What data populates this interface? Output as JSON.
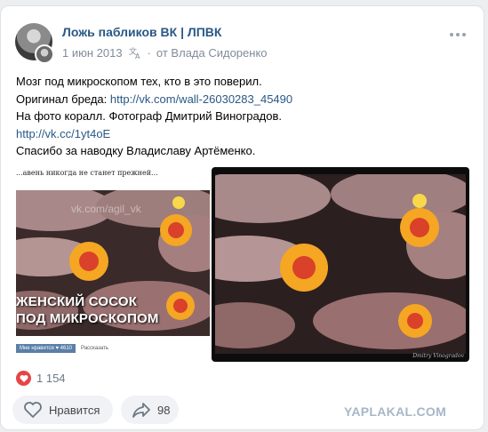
{
  "post": {
    "group_name": "Ложь пабликов ВК | ЛПВК",
    "date": "1 июн 2013",
    "author_separator": "·",
    "author": "от Влада Сидоренко",
    "text": {
      "line1": "Мозг под микроскопом тех, кто в это поверил.",
      "line2_prefix": "Оригинал бреда: ",
      "line2_link": "http://vk.com/wall-26030283_45490",
      "line3": "На фото коралл. Фотограф Дмитрий Виноградов.",
      "line4_link": "http://vk.cc/1yt4oE",
      "line5": "Спасибо за наводку Владиславу Артёменко."
    },
    "photo_left": {
      "caption": "...авень никогда не станет прежней...",
      "watermark": "vk.com/agil_vk",
      "overlay_line1": "ЖЕНСКИЙ СОСОК",
      "overlay_line2": "ПОД МИКРОСКОПОМ",
      "mini_button": "Мне нравится ♥ 4610",
      "mini_link": "Рассказать"
    },
    "photo_right": {
      "credit": "Dmitry Vinogradov"
    }
  },
  "reactions": {
    "count": "1 154"
  },
  "actions": {
    "like_label": "Нравится",
    "share_count": "98"
  },
  "watermark": "YAPLAKAL.COM",
  "colors": {
    "link": "#2a5885",
    "meta": "#818c99",
    "heart": "#e64646",
    "button_bg": "#f0f2f5"
  },
  "icons": [
    "more-icon",
    "translate-icon",
    "heart-icon",
    "share-icon"
  ]
}
